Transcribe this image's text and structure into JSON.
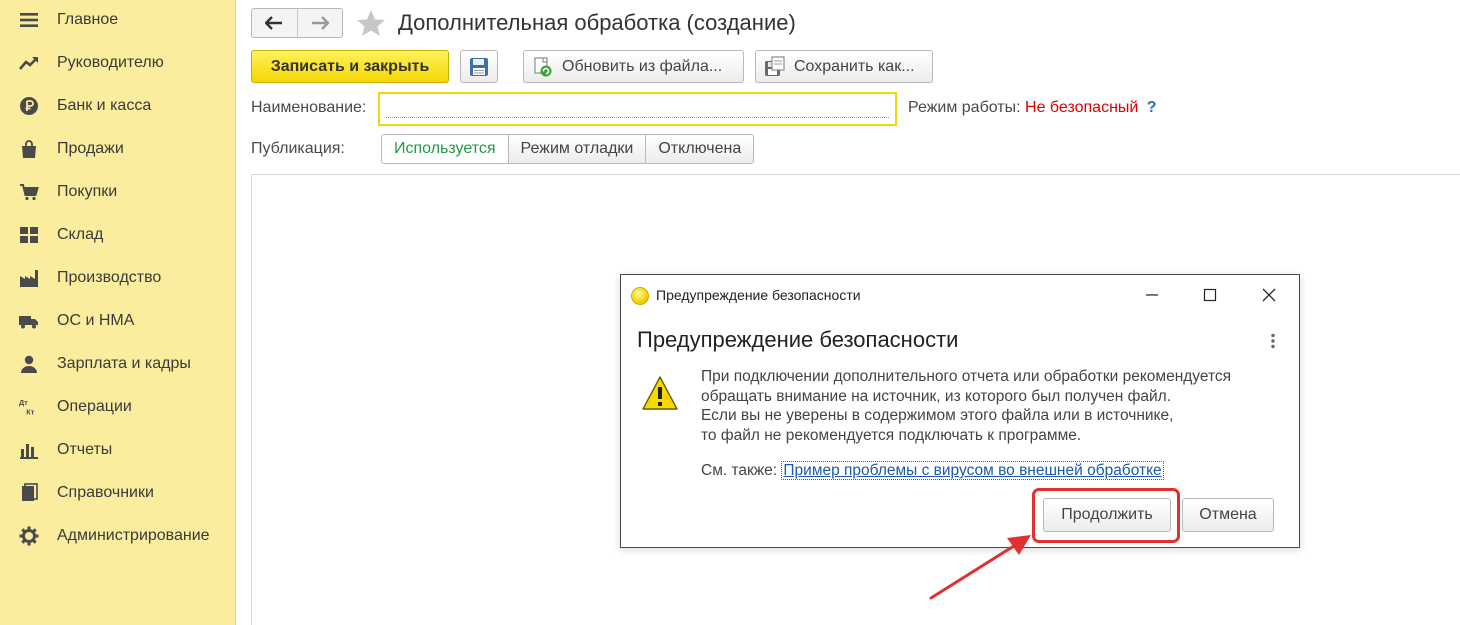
{
  "sidebar": {
    "items": [
      {
        "label": "Главное",
        "icon": "menu-lines-icon"
      },
      {
        "label": "Руководителю",
        "icon": "trend-up-icon"
      },
      {
        "label": "Банк и касса",
        "icon": "ruble-coin-icon"
      },
      {
        "label": "Продажи",
        "icon": "shopping-bag-icon"
      },
      {
        "label": "Покупки",
        "icon": "shopping-cart-icon"
      },
      {
        "label": "Склад",
        "icon": "warehouse-grid-icon"
      },
      {
        "label": "Производство",
        "icon": "factory-icon"
      },
      {
        "label": "ОС и НМА",
        "icon": "truck-icon"
      },
      {
        "label": "Зарплата и кадры",
        "icon": "person-icon"
      },
      {
        "label": "Операции",
        "icon": "debit-credit-icon"
      },
      {
        "label": "Отчеты",
        "icon": "bar-chart-icon"
      },
      {
        "label": "Справочники",
        "icon": "books-icon"
      },
      {
        "label": "Администрирование",
        "icon": "gear-icon"
      }
    ],
    "dt_text": "Дт",
    "kt_text": "Кт"
  },
  "header": {
    "title": "Дополнительная обработка (создание)"
  },
  "toolbar": {
    "save_close_label": "Записать и закрыть",
    "update_from_file_label": "Обновить из файла...",
    "save_as_label": "Сохранить как..."
  },
  "form": {
    "name_label": "Наименование:",
    "name_value": "",
    "mode_label": "Режим работы:",
    "mode_value": "Не безопасный",
    "help_label": "?",
    "publication_label": "Публикация:",
    "publication_options": [
      "Используется",
      "Режим отладки",
      "Отключена"
    ],
    "publication_selected": "Используется"
  },
  "dialog": {
    "window_title": "Предупреждение безопасности",
    "heading": "Предупреждение безопасности",
    "message_lines": [
      "При подключении дополнительного отчета или обработки рекомендуется",
      "обращать внимание на источник, из которого был получен файл.",
      "Если вы не уверены в содержимом этого файла или в источнике,",
      "то файл не рекомендуется подключать к программе."
    ],
    "see_also_label": "См. также:",
    "see_also_link": "Пример проблемы с вирусом во внешней обработке",
    "continue_label": "Продолжить",
    "cancel_label": "Отмена"
  },
  "colors": {
    "sidebar_bg": "#fbed9e",
    "primary_button": "#f4d705",
    "warning_text": "#e00000",
    "active_segment": "#1e9a4a",
    "annotation": "#e03030"
  }
}
